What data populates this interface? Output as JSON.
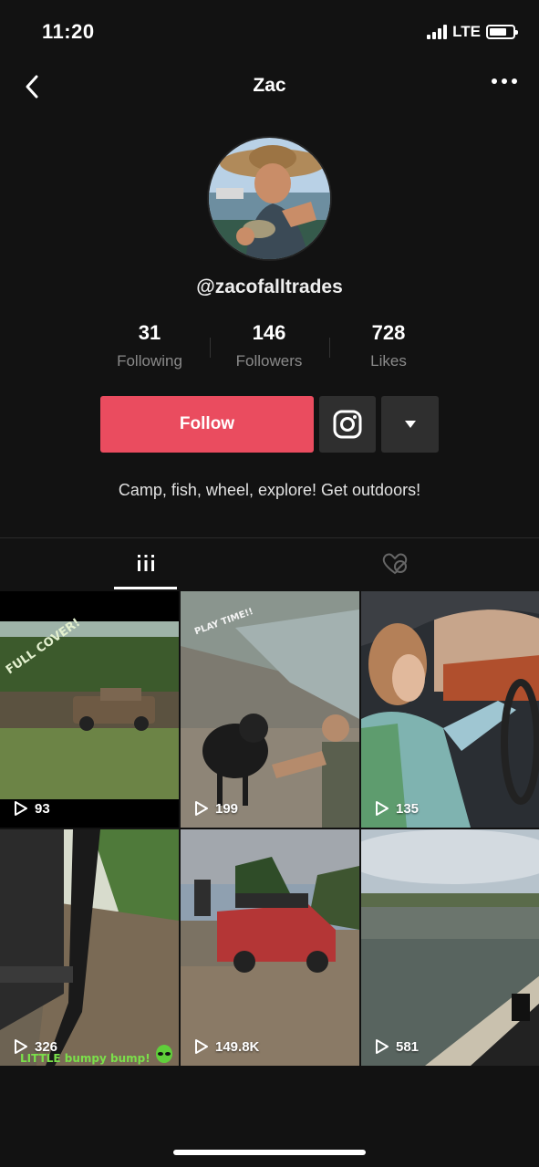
{
  "status_bar": {
    "time": "11:20",
    "network": "LTE",
    "battery_level": 0.75
  },
  "nav": {
    "title": "Zac",
    "back_icon": "chevron-left-icon",
    "more_icon": "ellipsis-icon"
  },
  "profile": {
    "handle": "@zacofalltrades",
    "stats": [
      {
        "value": "31",
        "label": "Following"
      },
      {
        "value": "146",
        "label": "Followers"
      },
      {
        "value": "728",
        "label": "Likes"
      }
    ],
    "follow_label": "Follow",
    "bio": "Camp, fish, wheel, explore!  Get outdoors!"
  },
  "tabs": {
    "videos_icon": "grid-icon",
    "liked_icon": "heart-hidden-icon"
  },
  "videos": [
    {
      "views": "93",
      "caption": "FULL COVER!"
    },
    {
      "views": "199",
      "caption": "PLAY TIME!!"
    },
    {
      "views": "135",
      "caption": ""
    },
    {
      "views": "326",
      "caption": "LITTLE bumpy bump!"
    },
    {
      "views": "149.8K",
      "caption": ""
    },
    {
      "views": "581",
      "caption": ""
    }
  ],
  "colors": {
    "accent": "#ea4c5f",
    "background": "#121212",
    "button": "#2f2f2f"
  }
}
